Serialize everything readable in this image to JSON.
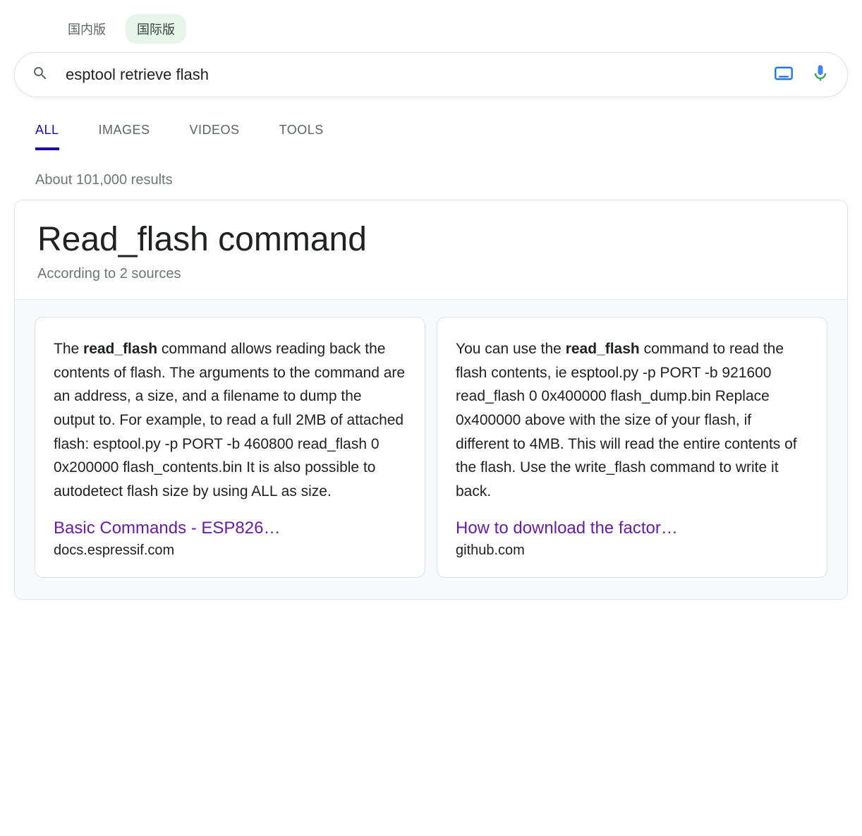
{
  "version_tabs": {
    "domestic": "国内版",
    "international": "国际版",
    "active": "international"
  },
  "search": {
    "query": "esptool retrieve flash"
  },
  "nav": {
    "all": "ALL",
    "images": "IMAGES",
    "videos": "VIDEOS",
    "tools": "TOOLS",
    "active": "all"
  },
  "results": {
    "count_text": "About 101,000 results"
  },
  "answer": {
    "title": "Read_flash command",
    "subtitle": "According to 2 sources",
    "cards": [
      {
        "text_html": "The <b>read_flash</b> command allows reading back the contents of flash. The arguments to the command are an address, a size, and a filename to dump the output to. For example, to read a full 2MB of attached flash: esptool.py -p PORT -b 460800 read_flash 0 0x200000 flash_contents.bin It is also possible to autodetect flash size by using ALL as size.",
        "link_text": "Basic Commands - ESP826…",
        "domain": "docs.espressif.com"
      },
      {
        "text_html": "You can use the <b>read_flash</b> command to read the flash contents, ie esptool.py -p PORT -b 921600 read_flash 0 0x400000 flash_dump.bin Replace 0x400000 above with the size of your flash, if different to 4MB. This will read the entire contents of the flash. Use the write_flash command to write it back.",
        "link_text": "How to download the factor…",
        "domain": "github.com"
      }
    ]
  }
}
